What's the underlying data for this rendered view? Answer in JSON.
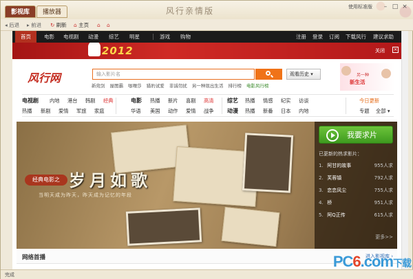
{
  "app": {
    "tabs": [
      "影视库",
      "播放器"
    ],
    "title": "风行亲情版",
    "window_controls": "使用标准版"
  },
  "navbar": {
    "back": "后退",
    "forward": "前进",
    "refresh": "刷新",
    "home": "主页"
  },
  "sitebar": {
    "items": [
      "首页",
      "电影",
      "电视剧",
      "动漫",
      "综艺",
      "明星",
      "游戏",
      "购物"
    ],
    "right": [
      "注册",
      "登录",
      "订阅",
      "下载风行",
      "建议求助"
    ]
  },
  "banner": {
    "year": "2012",
    "close_label": "关闭"
  },
  "header": {
    "logo": "风行网",
    "search_placeholder": "输入影片名",
    "history_label": "观看历史",
    "hot_words": [
      "新宛剑",
      "屋图霸",
      "咖喱莎",
      "猎豹试爱",
      "非诚勿扰",
      "另一种现出生活",
      "排行榜",
      "电影风行榜"
    ],
    "promo_line1": "另一种",
    "promo_line2": "新生活"
  },
  "categories": {
    "tv_title": "电视剧",
    "tv_row1": [
      "内地",
      "港台",
      "韩剧",
      "经典"
    ],
    "tv_row2": [
      "热播",
      "新剧",
      "爱情",
      "军旅",
      "家庭"
    ],
    "movie_title": "电影",
    "movie_row1": [
      "热播",
      "新片",
      "喜剧",
      "高清"
    ],
    "movie_row2": [
      "华语",
      "美国",
      "动作",
      "爱情",
      "战争"
    ],
    "variety_title": "综艺",
    "variety_row1": [
      "热播",
      "情感",
      "纪实",
      "访谈"
    ],
    "anime_title": "动漫",
    "anime_row2": [
      "热播",
      "新番",
      "日本",
      "内地"
    ],
    "today": "今日更新",
    "topic": "专题",
    "all": "全部"
  },
  "hero": {
    "label": "经典电影之",
    "title": "岁月如歌",
    "subtitle": "当明天成为昨天，昨天成为记忆的年段",
    "want_button": "我要求片",
    "list_title": "已更新的热求影片：",
    "requests": [
      {
        "n": "1.",
        "name": "阿甘的故事",
        "count": "955人求"
      },
      {
        "n": "2.",
        "name": "芙蓉镇",
        "count": "792人求"
      },
      {
        "n": "3.",
        "name": "恋恋风尘",
        "count": "755人求"
      },
      {
        "n": "4.",
        "name": "桥",
        "count": "951人求"
      },
      {
        "n": "5.",
        "name": "阿Q正传",
        "count": "615人求"
      }
    ],
    "more": "更多>>"
  },
  "network": {
    "title": "网络首播",
    "link": "进入影视库 ›"
  },
  "status": "完成",
  "watermark": {
    "pc": "PC",
    "six": "6",
    "dot": ".",
    "com": "com",
    "cn": "下载"
  }
}
